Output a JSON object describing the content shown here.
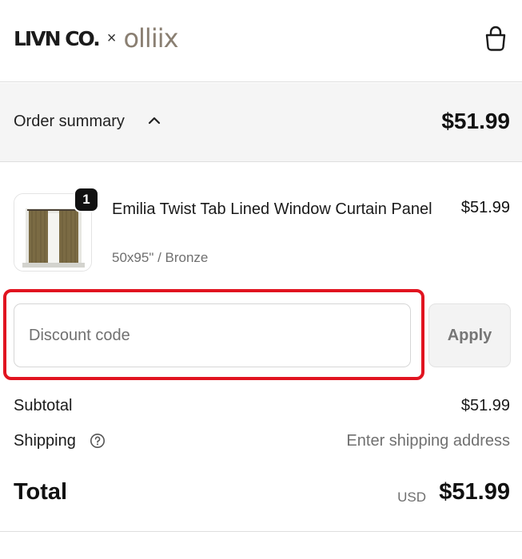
{
  "header": {
    "brand": "LIVN CO.",
    "separator": "×",
    "partner": "olliix",
    "cart_icon": "shopping-bag-icon"
  },
  "summary": {
    "label": "Order summary",
    "chevron_icon": "chevron-up-icon",
    "total": "$51.99"
  },
  "product": {
    "quantity": "1",
    "title": "Emilia Twist Tab Lined Window Curtain Panel",
    "variant": "50x95\" / Bronze",
    "price": "$51.99"
  },
  "discount": {
    "placeholder": "Discount code",
    "value": "",
    "apply_label": "Apply"
  },
  "totals": {
    "subtotal_label": "Subtotal",
    "subtotal_value": "$51.99",
    "shipping_label": "Shipping",
    "shipping_help_icon": "question-circle-icon",
    "shipping_value": "Enter shipping address",
    "total_label": "Total",
    "currency": "USD",
    "total_value": "$51.99"
  },
  "colors": {
    "highlight": "#e11420",
    "summary_bg": "#f5f5f5",
    "badge_bg": "#111111"
  }
}
